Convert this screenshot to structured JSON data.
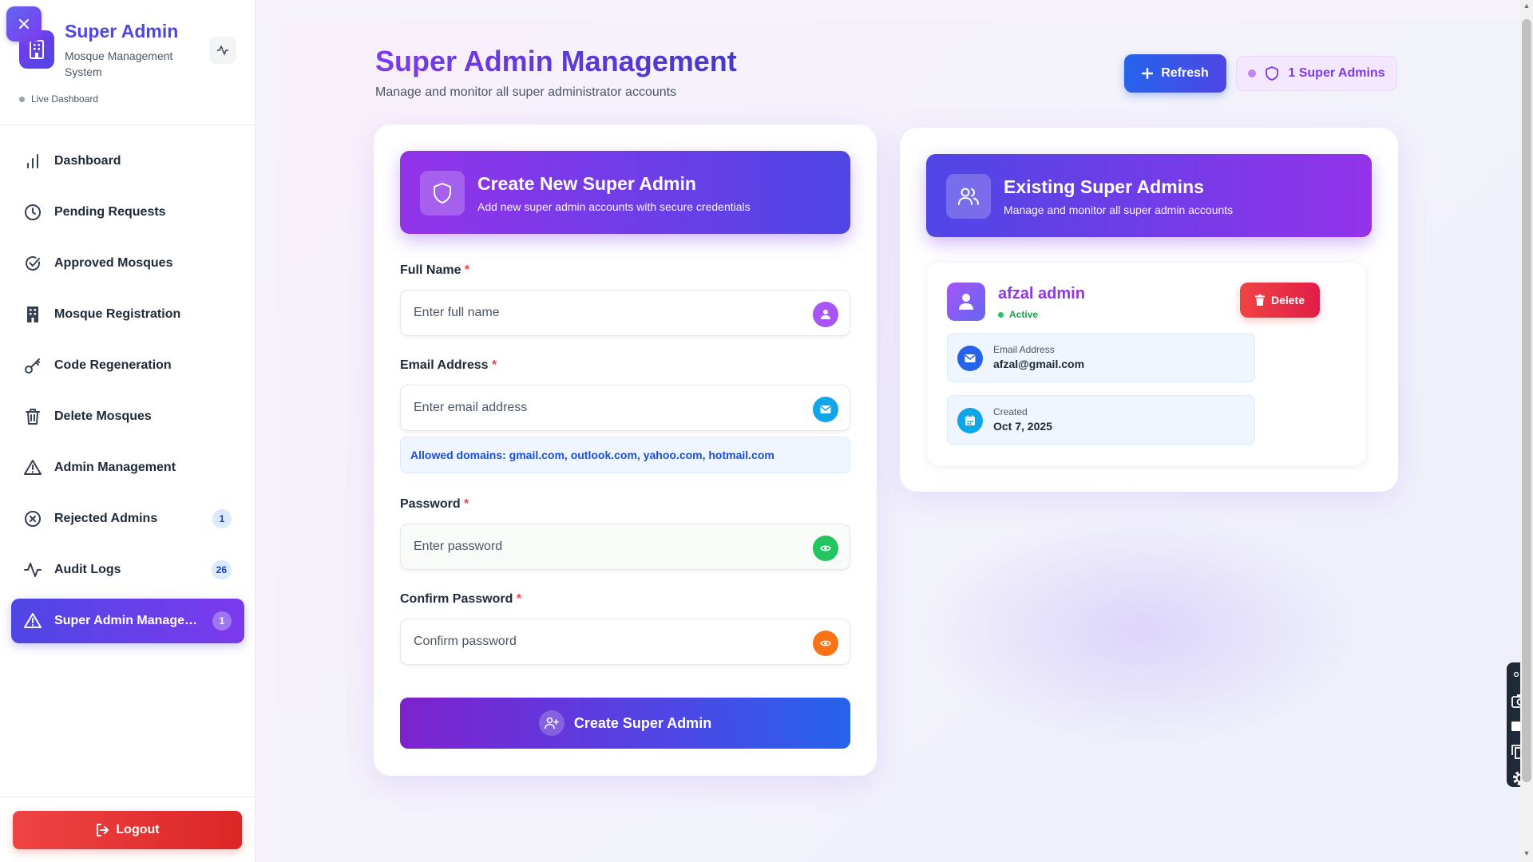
{
  "sidebar": {
    "close_icon": "close-icon",
    "brand_title": "Super Admin",
    "brand_subtitle": "Mosque Management System",
    "live_label": "Live Dashboard",
    "items": [
      {
        "label": "Dashboard",
        "icon": "bar-chart-icon",
        "badge": ""
      },
      {
        "label": "Pending Requests",
        "icon": "clock-icon",
        "badge": ""
      },
      {
        "label": "Approved Mosques",
        "icon": "check-circle-icon",
        "badge": ""
      },
      {
        "label": "Mosque Registration",
        "icon": "building-icon",
        "badge": ""
      },
      {
        "label": "Code Regeneration",
        "icon": "key-icon",
        "badge": ""
      },
      {
        "label": "Delete Mosques",
        "icon": "trash-icon",
        "badge": ""
      },
      {
        "label": "Admin Management",
        "icon": "warning-icon",
        "badge": ""
      },
      {
        "label": "Rejected Admins",
        "icon": "x-circle-icon",
        "badge": "1"
      },
      {
        "label": "Audit Logs",
        "icon": "activity-icon",
        "badge": "26"
      },
      {
        "label": "Super Admin Managem...",
        "icon": "warning-icon",
        "badge": "1"
      }
    ],
    "logout_label": "Logout"
  },
  "header": {
    "title": "Super Admin Management",
    "subtitle": "Manage and monitor all super administrator accounts",
    "refresh_label": "Refresh",
    "count_label": "1 Super Admins"
  },
  "create_form": {
    "title": "Create New Super Admin",
    "subtitle": "Add new super admin accounts with secure credentials",
    "full_name_label": "Full Name",
    "full_name_placeholder": "Enter full name",
    "email_label": "Email Address",
    "email_placeholder": "Enter email address",
    "domains_hint": "Allowed domains: gmail.com, outlook.com, yahoo.com, hotmail.com",
    "password_label": "Password",
    "password_placeholder": "Enter password",
    "confirm_label": "Confirm Password",
    "confirm_placeholder": "Confirm password",
    "required_mark": "*",
    "submit_label": "Create Super Admin"
  },
  "existing": {
    "title": "Existing Super Admins",
    "subtitle": "Manage and monitor all super admin accounts",
    "admins": [
      {
        "name": "afzal admin",
        "status": "Active",
        "delete_label": "Delete",
        "email_label": "Email Address",
        "email": "afzal@gmail.com",
        "created_label": "Created",
        "created": "Oct 7, 2025"
      }
    ]
  },
  "colors": {
    "primary": "#4f46e5",
    "accent": "#9333ea",
    "danger": "#ef4444",
    "success": "#22c55e"
  }
}
